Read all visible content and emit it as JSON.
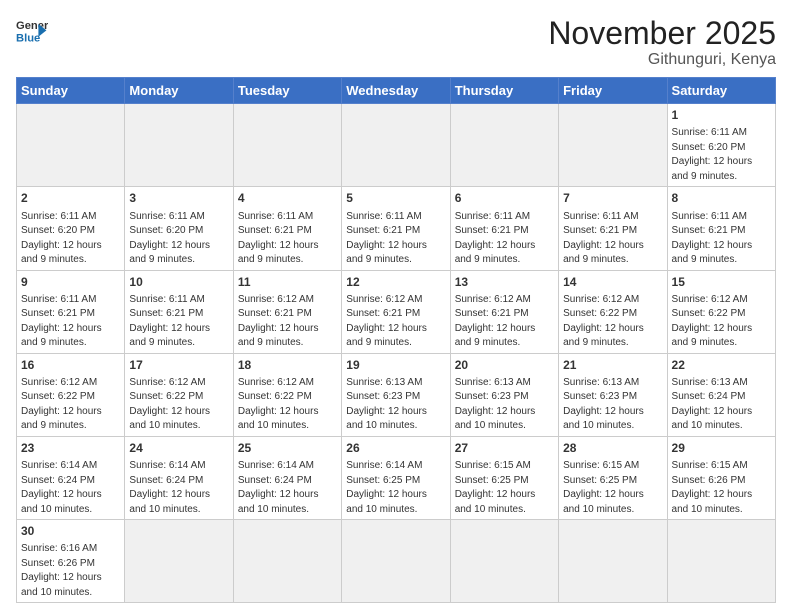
{
  "header": {
    "logo_general": "General",
    "logo_blue": "Blue",
    "month_title": "November 2025",
    "location": "Githunguri, Kenya"
  },
  "weekdays": [
    "Sunday",
    "Monday",
    "Tuesday",
    "Wednesday",
    "Thursday",
    "Friday",
    "Saturday"
  ],
  "days": {
    "1": {
      "sunrise": "6:11 AM",
      "sunset": "6:20 PM",
      "daylight": "12 hours and 9 minutes."
    },
    "2": {
      "sunrise": "6:11 AM",
      "sunset": "6:20 PM",
      "daylight": "12 hours and 9 minutes."
    },
    "3": {
      "sunrise": "6:11 AM",
      "sunset": "6:20 PM",
      "daylight": "12 hours and 9 minutes."
    },
    "4": {
      "sunrise": "6:11 AM",
      "sunset": "6:21 PM",
      "daylight": "12 hours and 9 minutes."
    },
    "5": {
      "sunrise": "6:11 AM",
      "sunset": "6:21 PM",
      "daylight": "12 hours and 9 minutes."
    },
    "6": {
      "sunrise": "6:11 AM",
      "sunset": "6:21 PM",
      "daylight": "12 hours and 9 minutes."
    },
    "7": {
      "sunrise": "6:11 AM",
      "sunset": "6:21 PM",
      "daylight": "12 hours and 9 minutes."
    },
    "8": {
      "sunrise": "6:11 AM",
      "sunset": "6:21 PM",
      "daylight": "12 hours and 9 minutes."
    },
    "9": {
      "sunrise": "6:11 AM",
      "sunset": "6:21 PM",
      "daylight": "12 hours and 9 minutes."
    },
    "10": {
      "sunrise": "6:11 AM",
      "sunset": "6:21 PM",
      "daylight": "12 hours and 9 minutes."
    },
    "11": {
      "sunrise": "6:12 AM",
      "sunset": "6:21 PM",
      "daylight": "12 hours and 9 minutes."
    },
    "12": {
      "sunrise": "6:12 AM",
      "sunset": "6:21 PM",
      "daylight": "12 hours and 9 minutes."
    },
    "13": {
      "sunrise": "6:12 AM",
      "sunset": "6:21 PM",
      "daylight": "12 hours and 9 minutes."
    },
    "14": {
      "sunrise": "6:12 AM",
      "sunset": "6:22 PM",
      "daylight": "12 hours and 9 minutes."
    },
    "15": {
      "sunrise": "6:12 AM",
      "sunset": "6:22 PM",
      "daylight": "12 hours and 9 minutes."
    },
    "16": {
      "sunrise": "6:12 AM",
      "sunset": "6:22 PM",
      "daylight": "12 hours and 9 minutes."
    },
    "17": {
      "sunrise": "6:12 AM",
      "sunset": "6:22 PM",
      "daylight": "12 hours and 10 minutes."
    },
    "18": {
      "sunrise": "6:12 AM",
      "sunset": "6:22 PM",
      "daylight": "12 hours and 10 minutes."
    },
    "19": {
      "sunrise": "6:13 AM",
      "sunset": "6:23 PM",
      "daylight": "12 hours and 10 minutes."
    },
    "20": {
      "sunrise": "6:13 AM",
      "sunset": "6:23 PM",
      "daylight": "12 hours and 10 minutes."
    },
    "21": {
      "sunrise": "6:13 AM",
      "sunset": "6:23 PM",
      "daylight": "12 hours and 10 minutes."
    },
    "22": {
      "sunrise": "6:13 AM",
      "sunset": "6:24 PM",
      "daylight": "12 hours and 10 minutes."
    },
    "23": {
      "sunrise": "6:14 AM",
      "sunset": "6:24 PM",
      "daylight": "12 hours and 10 minutes."
    },
    "24": {
      "sunrise": "6:14 AM",
      "sunset": "6:24 PM",
      "daylight": "12 hours and 10 minutes."
    },
    "25": {
      "sunrise": "6:14 AM",
      "sunset": "6:24 PM",
      "daylight": "12 hours and 10 minutes."
    },
    "26": {
      "sunrise": "6:14 AM",
      "sunset": "6:25 PM",
      "daylight": "12 hours and 10 minutes."
    },
    "27": {
      "sunrise": "6:15 AM",
      "sunset": "6:25 PM",
      "daylight": "12 hours and 10 minutes."
    },
    "28": {
      "sunrise": "6:15 AM",
      "sunset": "6:25 PM",
      "daylight": "12 hours and 10 minutes."
    },
    "29": {
      "sunrise": "6:15 AM",
      "sunset": "6:26 PM",
      "daylight": "12 hours and 10 minutes."
    },
    "30": {
      "sunrise": "6:16 AM",
      "sunset": "6:26 PM",
      "daylight": "12 hours and 10 minutes."
    }
  }
}
